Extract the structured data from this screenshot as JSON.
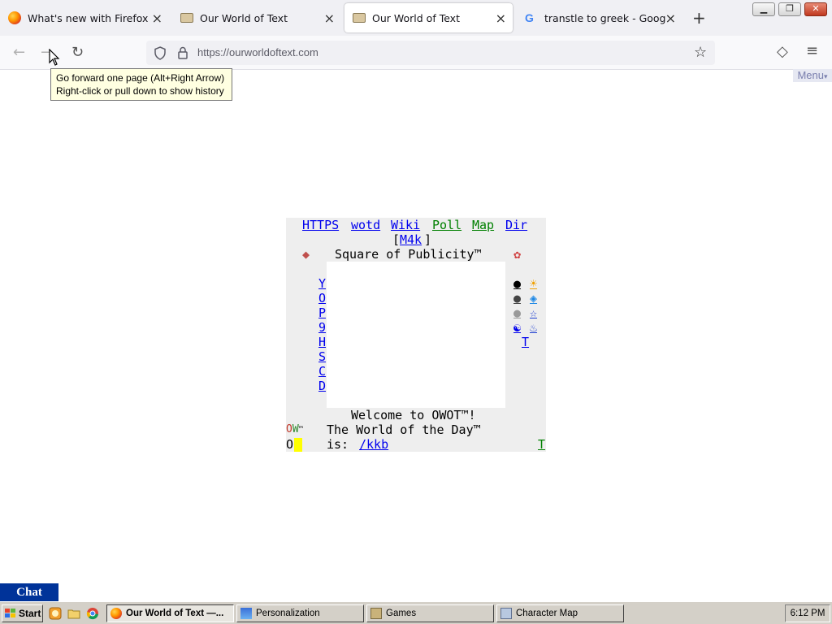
{
  "window": {
    "tabs": [
      {
        "title": "What's new with Firefox - Mo",
        "icon": "firefox-icon",
        "active": false
      },
      {
        "title": "Our World of Text",
        "icon": "owot-icon",
        "active": false
      },
      {
        "title": "Our World of Text",
        "icon": "owot-icon",
        "active": true
      },
      {
        "title": "transtle to greek - Google Se",
        "icon": "google-icon",
        "active": false
      }
    ],
    "close_glyph": "×",
    "new_tab_glyph": "+",
    "controls": {
      "minimize": "▁",
      "restore": "❐",
      "close": "✕"
    }
  },
  "navbar": {
    "back": "←",
    "forward": "→",
    "reload": "↻",
    "url": "https://ourworldoftext.com",
    "star": "☆",
    "pocket": "◇",
    "menu": "≡"
  },
  "tooltip": {
    "line1": "Go forward one page (Alt+Right Arrow)",
    "line2": "Right-click or pull down to show history"
  },
  "page": {
    "menu_label": "Menu",
    "menu_arrow": "▾",
    "owot": {
      "links_top": [
        "HTTPS",
        "wotd",
        "Wiki",
        "Poll",
        "Map",
        "Dir"
      ],
      "m4k": "M4k",
      "square_title": "Square of Publicity™",
      "left_column": [
        "Y",
        "O",
        "P",
        "9",
        "H",
        "S",
        "C",
        "D"
      ],
      "right_column": [
        "●",
        "●",
        "●",
        "☯",
        "T"
      ],
      "right_icons": [
        "☀",
        "◈",
        "☆",
        "♨"
      ],
      "welcome": "Welcome to OWOT™!",
      "wotd_line1": "The World of the Day™",
      "wotd_prefix": "is: ",
      "wotd_link": "/kkb",
      "ow_mark": "OW™",
      "o_mark": "O",
      "t_link": "T"
    },
    "chat_label": "Chat"
  },
  "taskbar": {
    "start_label": "Start",
    "items": [
      {
        "label": "Our World of Text —...",
        "active": true
      },
      {
        "label": "Personalization",
        "active": false
      },
      {
        "label": "Games",
        "active": false
      },
      {
        "label": "Character Map",
        "active": false
      }
    ],
    "clock": "6:12 PM"
  },
  "colors": {
    "link_blue": "#0000ee",
    "link_green": "#008000",
    "chat_blue": "#003399",
    "taskbar_gray": "#d4d0c8",
    "tooltip_yellow": "#ffffe1"
  }
}
